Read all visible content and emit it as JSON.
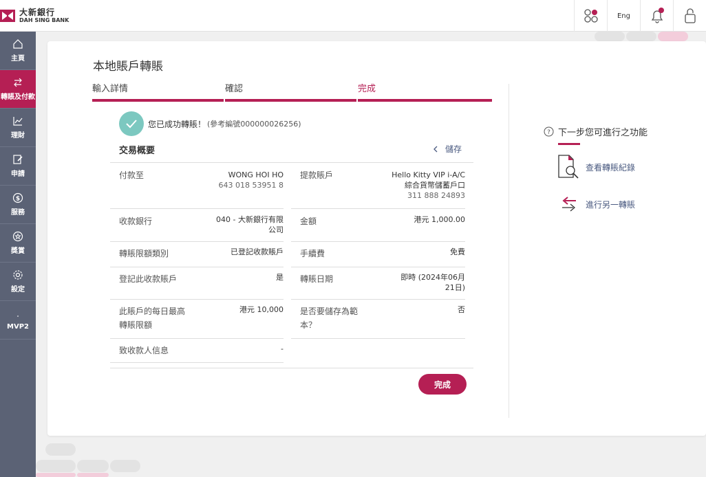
{
  "brand": {
    "name_zh": "大新銀行",
    "name_en": "DAH SING BANK",
    "color": "#b51f54"
  },
  "header": {
    "apps_icon": "apps-grid-icon",
    "language": "Eng",
    "notifications_icon": "bell-icon",
    "lock_icon": "lock-icon"
  },
  "sidebar": {
    "items": [
      {
        "label": "主頁",
        "icon": "home-icon"
      },
      {
        "label": "轉賬及付款",
        "icon": "transfer-icon",
        "active": true
      },
      {
        "label": "理財",
        "icon": "chart-icon"
      },
      {
        "label": "申請",
        "icon": "edit-icon"
      },
      {
        "label": "服務",
        "icon": "dollar-icon"
      },
      {
        "label": "獎賞",
        "icon": "star-icon"
      },
      {
        "label": "設定",
        "icon": "gear-icon"
      },
      {
        "label": "MVP2",
        "icon": "dot-icon"
      }
    ]
  },
  "page": {
    "title": "本地賬戶轉賬",
    "steps": [
      {
        "label": "輸入詳情"
      },
      {
        "label": "確認"
      },
      {
        "label": "完成",
        "current": true
      }
    ],
    "success_message": "您已成功轉賬！",
    "reference_prefix": "(參考編號 ",
    "reference_number": "000000026256",
    "reference_suffix": ")",
    "summary_title": "交易概要",
    "save_label": "儲存",
    "left_rows": [
      {
        "label": "付款至",
        "value": "WONG HOI HO",
        "sub": "643 018 53951 8"
      },
      {
        "label": "收款銀行",
        "value": "040 - 大新銀行有限",
        "value2": "公司"
      },
      {
        "label": "轉賬限額類別",
        "value": "已登記收款賬戶"
      },
      {
        "label": "登記此收款賬戶",
        "value": "是"
      },
      {
        "label": "此賬戶的每日最高",
        "label2": "轉賬限額",
        "value": "港元 10,000"
      },
      {
        "label": "致收款人信息",
        "value": "-"
      }
    ],
    "right_rows": [
      {
        "label": "提款賬戶",
        "value": "Hello Kitty VIP i-A/C",
        "value2": "綜合貨幣儲蓄戶口",
        "sub": "311 888 24893"
      },
      {
        "label": "金額",
        "value": "港元 1,000.00"
      },
      {
        "label": "手續費",
        "value": "免費"
      },
      {
        "label": "轉賬日期",
        "value": "即時 (2024年06月",
        "value2": "21日)"
      },
      {
        "label": "是否要儲存為範",
        "label2": "本？",
        "value": "否"
      }
    ],
    "done_button": "完成"
  },
  "next_steps": {
    "title": "下一步您可進行之功能",
    "links": [
      {
        "label": "查看轉賬紀錄",
        "icon": "search-document-icon"
      },
      {
        "label": "進行另一轉賬",
        "icon": "transfer-arrows-icon"
      }
    ]
  }
}
